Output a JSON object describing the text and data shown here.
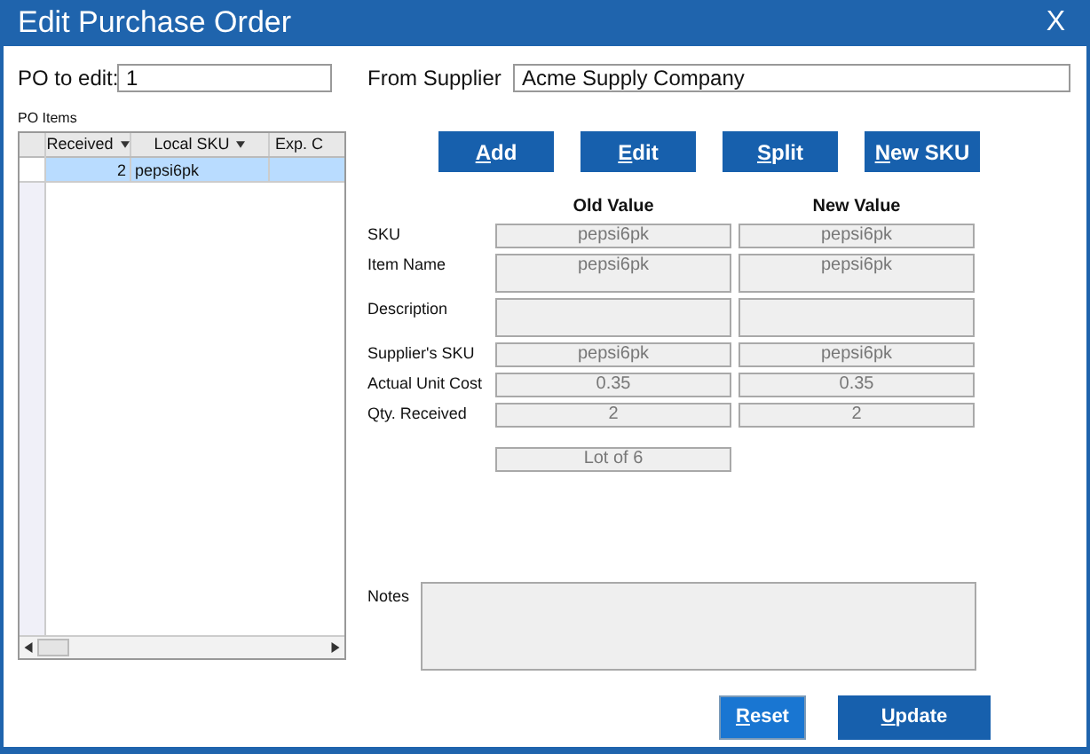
{
  "window": {
    "title": "Edit Purchase Order",
    "close": "X"
  },
  "po_to_edit": {
    "label": "PO to edit:",
    "value": "1"
  },
  "supplier": {
    "label": "From Supplier",
    "value": "Acme Supply Company"
  },
  "po_items": {
    "label": "PO Items",
    "columns": [
      "Received",
      "Local SKU",
      "Exp. C"
    ],
    "rows": [
      {
        "cells": [
          "2",
          "pepsi6pk"
        ],
        "selected": true
      }
    ]
  },
  "actions": [
    {
      "access_key": "A",
      "label_rest": "dd"
    },
    {
      "access_key": "E",
      "label_rest": "dit"
    },
    {
      "access_key": "S",
      "label_rest": "plit"
    },
    {
      "access_key": "N",
      "label_rest": "ew SKU"
    }
  ],
  "compare": {
    "old_heading": "Old Value",
    "new_heading": "New Value",
    "rows": [
      {
        "label": "SKU",
        "kind": "line",
        "old": "pepsi6pk",
        "new": "pepsi6pk"
      },
      {
        "label": "Item Name",
        "kind": "area",
        "old": "pepsi6pk",
        "new": "pepsi6pk"
      },
      {
        "label": "Description",
        "kind": "area",
        "old": "",
        "new": ""
      },
      {
        "label": "Supplier's SKU",
        "kind": "line",
        "old": "pepsi6pk",
        "new": "pepsi6pk"
      },
      {
        "label": "Actual Unit Cost",
        "kind": "line",
        "old": "0.35",
        "new": "0.35"
      },
      {
        "label": "Qty. Received",
        "kind": "line",
        "old": "2",
        "new": "2"
      }
    ]
  },
  "lot": "Lot of 6",
  "notes": {
    "label": "Notes"
  },
  "footer_buttons": [
    {
      "access_key": "R",
      "label_rest": "eset",
      "kind": "light"
    },
    {
      "access_key": "U",
      "label_rest": "pdate",
      "kind": "dark"
    }
  ]
}
